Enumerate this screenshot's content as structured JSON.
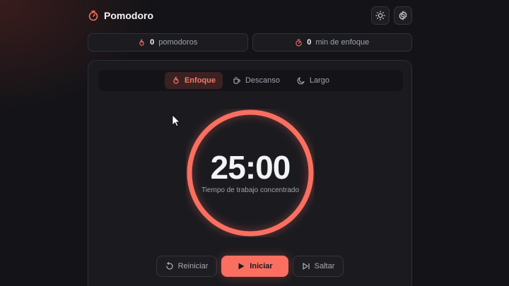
{
  "app": {
    "title": "Pomodoro"
  },
  "header": {
    "theme_icon": "sun-icon",
    "settings_icon": "gear-icon"
  },
  "stats": {
    "pomodoros": {
      "value": "0",
      "label": "pomodoros"
    },
    "focus": {
      "value": "0",
      "label": "min de enfoque"
    }
  },
  "tabs": [
    {
      "label": "Enfoque",
      "icon": "flame-icon",
      "active": true
    },
    {
      "label": "Descanso",
      "icon": "cup-icon",
      "active": false
    },
    {
      "label": "Largo",
      "icon": "moon-icon",
      "active": false
    }
  ],
  "timer": {
    "time": "25:00",
    "subtitle": "Tiempo de trabajo concentrado",
    "progress": 1.0
  },
  "controls": {
    "reset_label": "Reiniciar",
    "start_label": "Iniciar",
    "skip_label": "Saltar"
  },
  "colors": {
    "accent": "#fa6f60",
    "background": "#141418",
    "card": "#1a1a1f"
  }
}
